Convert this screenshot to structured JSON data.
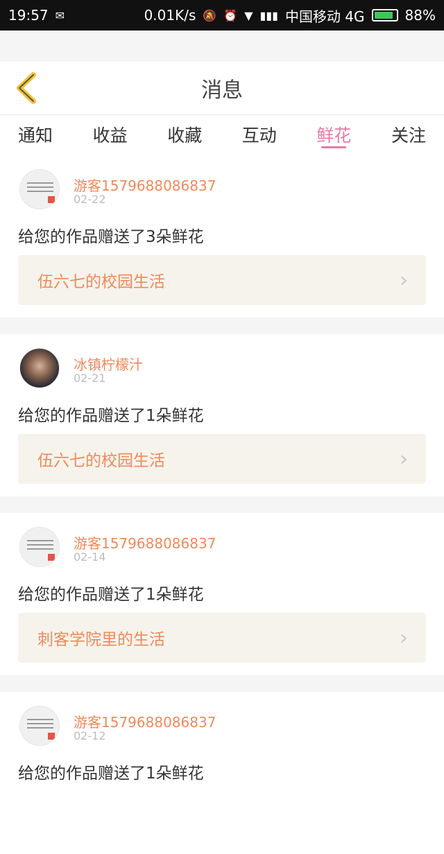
{
  "status_bar": {
    "time": "19:57",
    "network_speed": "0.01K/s",
    "carrier": "中国移动 4G",
    "battery_pct": "88%",
    "battery_level": 0.88
  },
  "header": {
    "title": "消息"
  },
  "tabs": [
    {
      "label": "通知",
      "active": false
    },
    {
      "label": "收益",
      "active": false
    },
    {
      "label": "收藏",
      "active": false
    },
    {
      "label": "互动",
      "active": false
    },
    {
      "label": "鲜花",
      "active": true
    },
    {
      "label": "关注",
      "active": false
    }
  ],
  "messages": [
    {
      "user": "游客1579688086837",
      "date": "02-22",
      "text": "给您的作品赠送了3朵鲜花",
      "work": "伍六七的校园生活"
    },
    {
      "user": "冰镇柠檬汁",
      "date": "02-21",
      "text": "给您的作品赠送了1朵鲜花",
      "work": "伍六七的校园生活"
    },
    {
      "user": "游客1579688086837",
      "date": "02-14",
      "text": "给您的作品赠送了1朵鲜花",
      "work": "刺客学院里的生活"
    },
    {
      "user": "游客1579688086837",
      "date": "02-12",
      "text": "给您的作品赠送了1朵鲜花",
      "work": ""
    }
  ]
}
